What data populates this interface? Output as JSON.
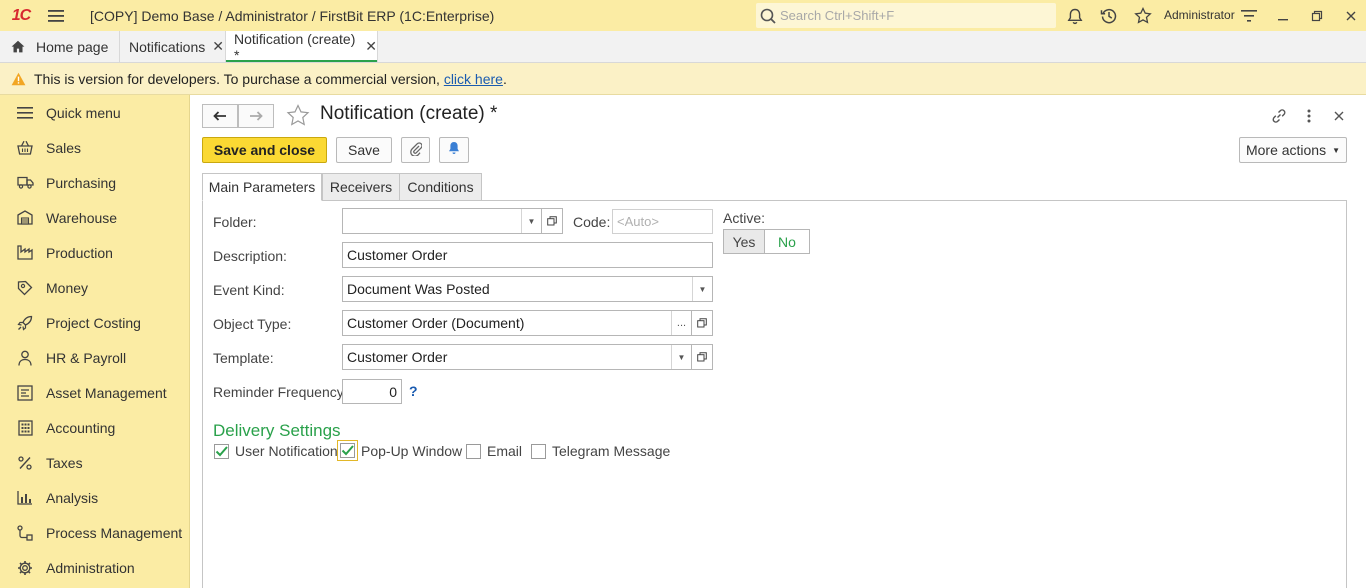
{
  "titlebar": {
    "logo": "1С",
    "title": "[COPY] Demo Base / Administrator / FirstBit ERP  (1C:Enterprise)",
    "search_placeholder": "Search Ctrl+Shift+F",
    "user": "Administrator"
  },
  "tabs": [
    {
      "label": "Home page",
      "icon": "home-icon"
    },
    {
      "label": "Notifications",
      "closable": true
    },
    {
      "label": "Notification (create) *",
      "closable": true,
      "active": true
    }
  ],
  "warning": {
    "text": "This is version for developers. To purchase a commercial version, ",
    "link": "click here",
    "tail": "."
  },
  "sidebar": {
    "items": [
      {
        "label": "Quick menu",
        "icon": "menu-lines-icon"
      },
      {
        "label": "Sales",
        "icon": "basket-icon"
      },
      {
        "label": "Purchasing",
        "icon": "truck-icon"
      },
      {
        "label": "Warehouse",
        "icon": "warehouse-icon"
      },
      {
        "label": "Production",
        "icon": "factory-icon"
      },
      {
        "label": "Money",
        "icon": "money-icon"
      },
      {
        "label": "Project Costing",
        "icon": "rocket-icon"
      },
      {
        "label": "HR & Payroll",
        "icon": "person-icon"
      },
      {
        "label": "Asset Management",
        "icon": "asset-icon"
      },
      {
        "label": "Accounting",
        "icon": "calculator-icon"
      },
      {
        "label": "Taxes",
        "icon": "percent-icon"
      },
      {
        "label": "Analysis",
        "icon": "bar-chart-icon"
      },
      {
        "label": "Process Management",
        "icon": "process-icon"
      },
      {
        "label": "Administration",
        "icon": "gear-icon"
      }
    ]
  },
  "form": {
    "title": "Notification (create) *",
    "buttons": {
      "save_and_close": "Save and close",
      "save": "Save",
      "more_actions": "More actions"
    },
    "tabs": [
      "Main Parameters",
      "Receivers",
      "Conditions"
    ],
    "fields": {
      "folder_label": "Folder:",
      "folder_value": "",
      "code_label": "Code:",
      "code_placeholder": "<Auto>",
      "active_label": "Active:",
      "active_yes": "Yes",
      "active_no": "No",
      "active_selected": "No",
      "description_label": "Description:",
      "description_value": "Customer Order",
      "event_kind_label": "Event Kind:",
      "event_kind_value": "Document Was Posted",
      "object_type_label": "Object Type:",
      "object_type_value": "Customer Order (Document)",
      "template_label": "Template:",
      "template_value": "Customer Order",
      "reminder_label": "Reminder Frequency:",
      "reminder_value": "0",
      "help": "?"
    },
    "delivery": {
      "title": "Delivery Settings",
      "options": [
        {
          "label": "User Notification",
          "checked": true
        },
        {
          "label": "Pop-Up Window",
          "checked": true
        },
        {
          "label": "Email",
          "checked": false
        },
        {
          "label": "Telegram Message",
          "checked": false
        }
      ]
    }
  },
  "colors": {
    "titlebar_bg": "#fbeca4",
    "accent_green": "#2aa14b",
    "primary_button": "#fbd933",
    "link": "#1a5bb0"
  }
}
